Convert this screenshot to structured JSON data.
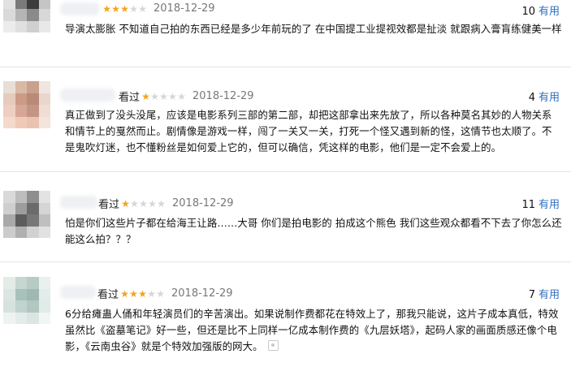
{
  "comments": [
    {
      "status": "",
      "rating": 3,
      "date": "2018-12-29",
      "votes": "10",
      "votes_label": "有用",
      "text": "导演太膨胀 不知道自己拍的东西已经是多少年前玩的了 在中国提工业提视效都是扯淡 就跟病入膏肓练健美一样"
    },
    {
      "status": "看过",
      "rating": 1,
      "date": "2018-12-29",
      "votes": "4",
      "votes_label": "有用",
      "text": "真正做到了没头没尾，应该是电影系列三部的第二部，却把这部拿出来先放了，所以各种莫名其妙的人物关系和情节上的戛然而止。剧情像是游戏一样，闯了一关又一关，打死一个怪又遇到新的怪，这情节也太顺了。不是鬼吹灯迷，也不懂粉丝是如何爱上它的，但可以确信，凭这样的电影，他们是一定不会爱上的。"
    },
    {
      "status": "看过",
      "rating": 1,
      "date": "2018-12-29",
      "votes": "11",
      "votes_label": "有用",
      "text": "怕是你们这些片子都在给海王让路……大哥 你们是拍电影的 拍成这个熊色 我们这些观众都看不下去了你怎么还能这么拍？？？"
    },
    {
      "status": "看过",
      "rating": 3,
      "date": "2018-12-29",
      "votes": "7",
      "votes_label": "有用",
      "text": "6分给瘫蛊人俑和年轻演员们的辛苦演出。如果说制作费都花在特效上了，那我只能说，这片子成本真低，特效虽然比《盗墓笔记》好一些，但还是比不上同样一亿成本制作费的《九层妖塔》，起码人家的画面质感还像个电影，《云南虫谷》就是个特效加强版的网大。"
    }
  ]
}
